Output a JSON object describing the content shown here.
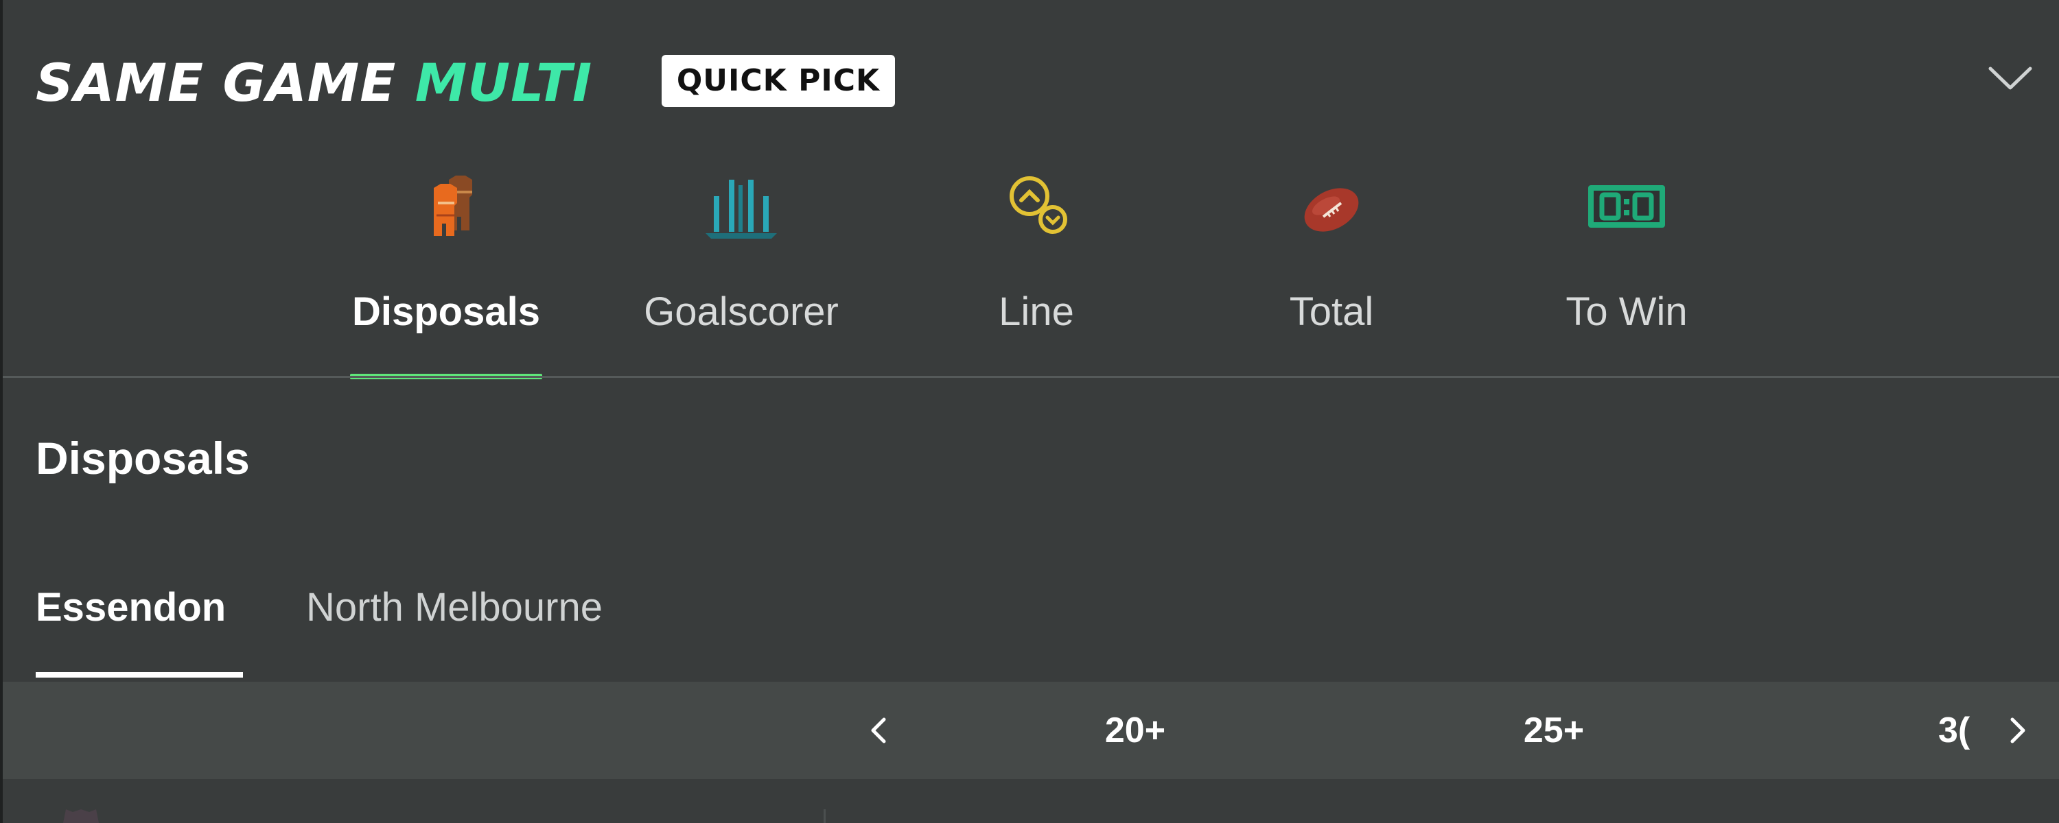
{
  "header": {
    "brand_part1": "SAME GAME",
    "brand_part2": "MULTI",
    "badge": "QUICK PICK",
    "accent_color": "#3ee8a8"
  },
  "market_tabs": [
    {
      "label": "Disposals",
      "icon": "jerseys-icon",
      "active": true
    },
    {
      "label": "Goalscorer",
      "icon": "goalposts-icon",
      "active": false
    },
    {
      "label": "Line",
      "icon": "line-arrows-icon",
      "active": false
    },
    {
      "label": "Total",
      "icon": "football-icon",
      "active": false
    },
    {
      "label": "To Win",
      "icon": "scoreboard-icon",
      "active": false
    }
  ],
  "active_underline_color": "#5fe67a",
  "section": {
    "title": "Disposals"
  },
  "team_tabs": [
    {
      "label": "Essendon",
      "active": true
    },
    {
      "label": "North Melbourne",
      "active": false
    }
  ],
  "odds_columns": [
    "20+",
    "25+",
    "3("
  ]
}
